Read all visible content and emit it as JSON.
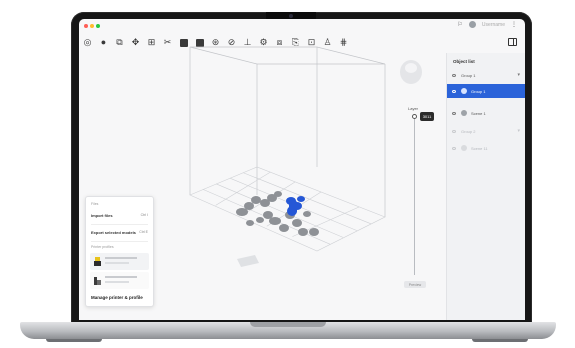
{
  "window": {
    "controls": [
      "#ff5f57",
      "#febc2e",
      "#28c840"
    ],
    "account_label": "Username"
  },
  "toolbar": {
    "icons": [
      "target-icon",
      "sphere-icon",
      "copy-icon",
      "move-icon",
      "grid-icon",
      "cut-icon",
      "box-icon",
      "layers-icon",
      "settings-icon",
      "tag-icon",
      "support-icon",
      "gear-icon",
      "duplicate-icon",
      "paste-icon",
      "frame-icon",
      "user-icon",
      "scan-icon"
    ]
  },
  "object_list": {
    "title": "Object list",
    "items": [
      {
        "label": "Group 1",
        "state": "normal"
      },
      {
        "label": "Group 1",
        "state": "selected"
      },
      {
        "label": "Scene 1",
        "state": "normal"
      },
      {
        "label": "Group 2",
        "state": "dim"
      },
      {
        "label": "Scene 11",
        "state": "dim"
      }
    ]
  },
  "layer": {
    "label": "Layer",
    "value": "3011",
    "button_label": "Preview"
  },
  "popover": {
    "heading": "Files",
    "row1_label": "Import files",
    "row1_shortcut": "Ctrl I",
    "row2_label": "Export selected models",
    "row2_shortcut": "Ctrl E",
    "section_label": "Printer profiles",
    "footer_label": "Manage printer & profile"
  },
  "colors": {
    "accent": "#2b63d9",
    "model_grey": "#8e9196",
    "model_blue": "#2557d6"
  }
}
